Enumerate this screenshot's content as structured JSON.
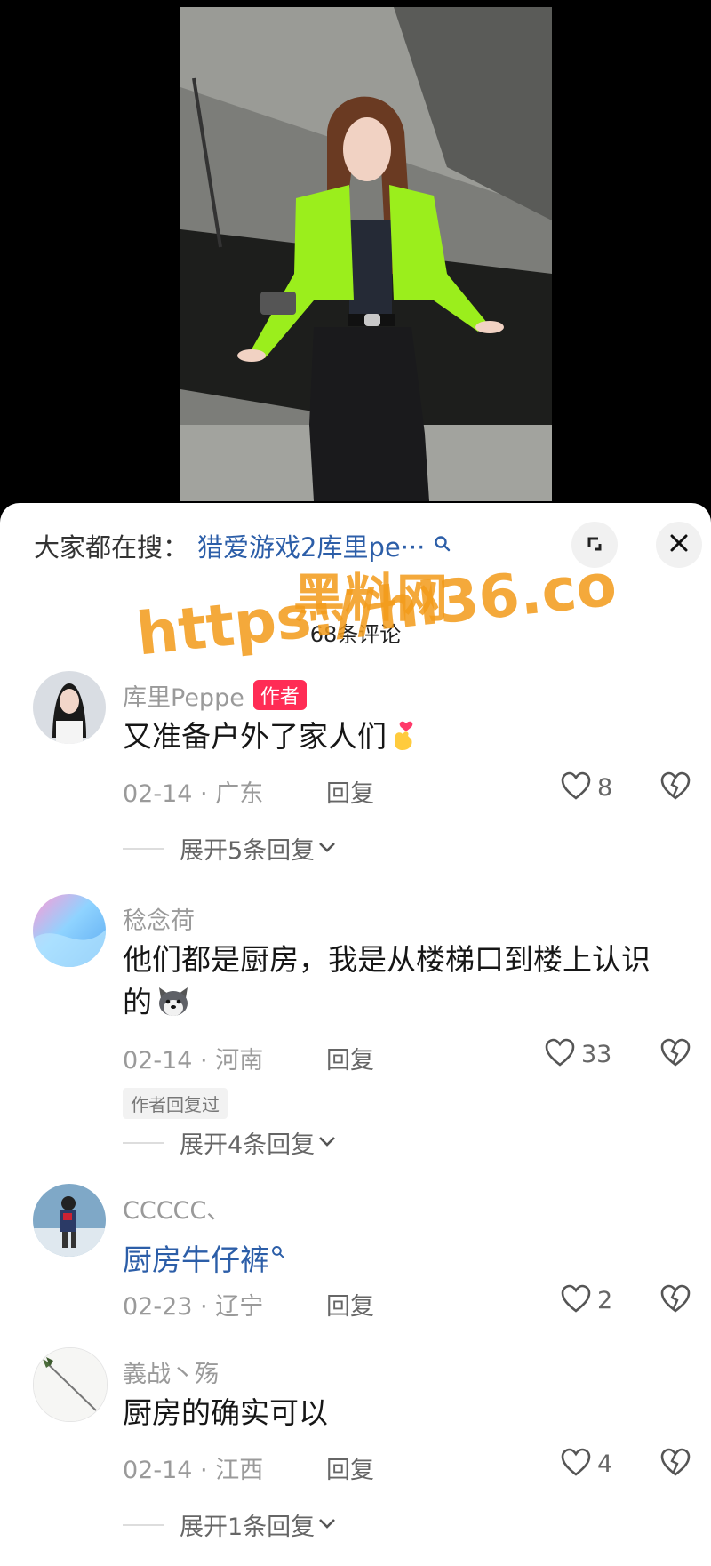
{
  "search": {
    "prefix": "大家都在搜：",
    "term": "猎爱游戏2库里pe···"
  },
  "watermark": {
    "line1": "黑料网",
    "line2": "https://hl36.co"
  },
  "comments_title": "68条评论",
  "comments": [
    {
      "username": "库里Peppe",
      "badge": "作者",
      "text": "又准备户外了家人们",
      "date": "02-14 · 广东",
      "reply": "回复",
      "likes": "8",
      "expand": "展开5条回复"
    },
    {
      "username": "稔念荷",
      "text_line1": "他们都是厨房，我是从楼梯口到楼上认识",
      "text_line2": "的",
      "date": "02-14 · 河南",
      "reply": "回复",
      "likes": "33",
      "author_tag": "作者回复过",
      "expand": "展开4条回复"
    },
    {
      "username": "CCCCC、",
      "text": "厨房牛仔裤",
      "date": "02-23 · 辽宁",
      "reply": "回复",
      "likes": "2"
    },
    {
      "username": "義战丶殇",
      "text": "厨房的确实可以",
      "date": "02-14 · 江西",
      "reply": "回复",
      "likes": "4",
      "expand": "展开1条回复"
    }
  ],
  "colors": {
    "link": "#2c5ea8",
    "author_badge": "#ff2c55",
    "watermark": "#f39b1a"
  },
  "icons": {
    "search": "search-icon",
    "expand": "expand-icon",
    "close": "close-icon",
    "like": "heart-icon",
    "dislike": "broken-heart-icon",
    "chevron": "chevron-down-icon"
  }
}
